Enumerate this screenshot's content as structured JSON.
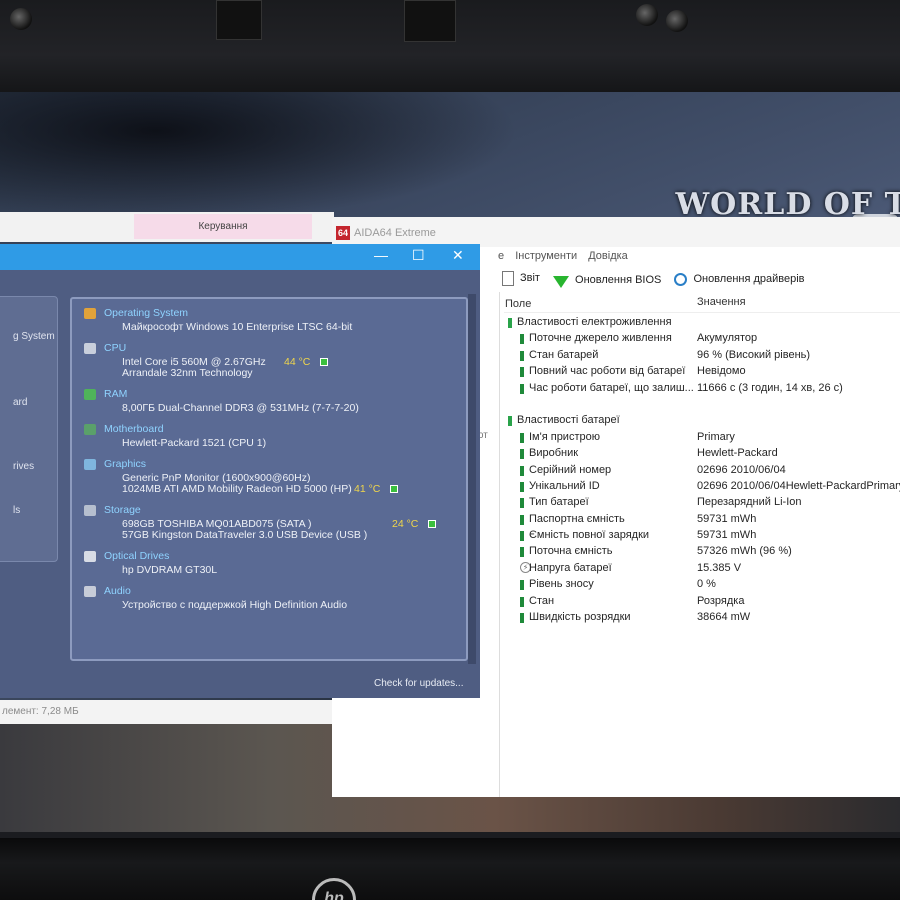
{
  "desktop": {
    "game_title": "WORLD OF T",
    "emblem": "T"
  },
  "background_explorer": {
    "tab_label": "Керування",
    "status_text": "лемент: 7,28 МБ",
    "side_text": "ют"
  },
  "aida_window": {
    "title": "AIDA64 Extreme",
    "logo": "64",
    "menu": [
      "е",
      "Інструменти",
      "Довідка"
    ],
    "toolbar": {
      "report": "Звіт",
      "bios_update": "Оновлення BIOS",
      "driver_update": "Оновлення драйверів"
    },
    "columns": {
      "field": "Поле",
      "value": "Значення"
    },
    "rows": [
      {
        "type": "group",
        "field": "Властивості електроживлення",
        "value": ""
      },
      {
        "type": "item",
        "field": "Поточне джерело живлення",
        "value": "Акумулятор"
      },
      {
        "type": "item",
        "field": "Стан батарей",
        "value": "96 % (Високий рівень)"
      },
      {
        "type": "item",
        "field": "Повний час роботи від батареї",
        "value": "Невідомо"
      },
      {
        "type": "item",
        "field": "Час роботи батареї, що залиш...",
        "value": "11666 с (3 годин, 14 хв, 26 с)"
      },
      {
        "type": "spacer",
        "field": "",
        "value": ""
      },
      {
        "type": "group",
        "field": "Властивості батареї",
        "value": ""
      },
      {
        "type": "item",
        "field": "Ім'я пристрою",
        "value": "Primary"
      },
      {
        "type": "item",
        "field": "Виробник",
        "value": "Hewlett-Packard"
      },
      {
        "type": "item",
        "field": "Серійний номер",
        "value": "02696 2010/06/04"
      },
      {
        "type": "item",
        "field": "Унікальний ID",
        "value": "02696 2010/06/04Hewlett-PackardPrimary"
      },
      {
        "type": "item",
        "field": "Тип батареї",
        "value": "Перезарядний Li-Ion"
      },
      {
        "type": "item",
        "field": "Паспортна ємність",
        "value": "59731 mWh"
      },
      {
        "type": "item",
        "field": "Ємність повної зарядки",
        "value": "59731 mWh"
      },
      {
        "type": "item",
        "field": "Поточна ємність",
        "value": "57326 mWh  (96 %)"
      },
      {
        "type": "volt",
        "field": "Напруга батареї",
        "value": "15.385 V"
      },
      {
        "type": "item",
        "field": "Рівень зносу",
        "value": "0 %"
      },
      {
        "type": "item",
        "field": "Стан",
        "value": "Розрядка"
      },
      {
        "type": "item",
        "field": "Швидкість розрядки",
        "value": "38664 mW"
      }
    ],
    "scroll_left": "‹",
    "scroll_right": "›"
  },
  "summary_window": {
    "controls": {
      "minimize": "—",
      "maximize": "☐",
      "close": "✕"
    },
    "nav": [
      "g System",
      "ard",
      "rives",
      "ls"
    ],
    "categories": [
      {
        "title": "Operating System",
        "lines": [
          "Майкрософт Windows 10 Enterprise LTSC 64-bit"
        ],
        "icon_color": "#e0a23a"
      },
      {
        "title": "CPU",
        "lines": [
          "Intel Core i5 560M @ 2.67GHz",
          "Arrandale 32nm Technology"
        ],
        "temp": "44 °C",
        "icon_color": "#c9cfdc"
      },
      {
        "title": "RAM",
        "lines": [
          "8,00ГБ Dual-Channel DDR3 @ 531MHz (7-7-7-20)"
        ],
        "icon_color": "#4fb35a"
      },
      {
        "title": "Motherboard",
        "lines": [
          "Hewlett-Packard 1521 (CPU 1)"
        ],
        "icon_color": "#5aa06a"
      },
      {
        "title": "Graphics",
        "lines": [
          "Generic PnP Monitor (1600x900@60Hz)",
          "1024MB ATI AMD Mobility Radeon HD 5000 (HP)"
        ],
        "temp": "41 °C",
        "icon_color": "#7fb6de"
      },
      {
        "title": "Storage",
        "lines": [
          "698GB TOSHIBA MQ01ABD075 (SATA )",
          "57GB Kingston DataTraveler 3.0 USB Device (USB )"
        ],
        "temp": "24 °C",
        "icon_color": "#b6bfcf"
      },
      {
        "title": "Optical Drives",
        "lines": [
          "hp DVDRAM GT30L"
        ],
        "icon_color": "#d8dce6"
      },
      {
        "title": "Audio",
        "lines": [
          "Устройство с поддержкой High Definition Audio"
        ],
        "icon_color": "#c7ccd8"
      }
    ],
    "check_updates": "Check for updates..."
  },
  "taskbar": {
    "tray_icons": [
      "chevron-up",
      "battery",
      "speaker",
      "wifi"
    ]
  }
}
